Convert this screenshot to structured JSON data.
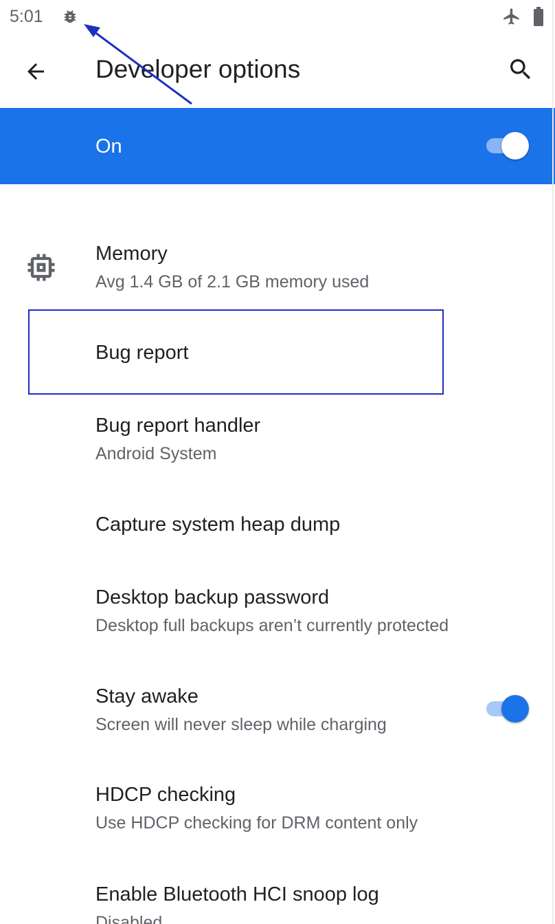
{
  "status_bar": {
    "time": "5:01",
    "icons": [
      "bug-icon",
      "airplane-mode-icon",
      "battery-icon"
    ]
  },
  "app_bar": {
    "title": "Developer options",
    "back_icon": "arrow-back-icon",
    "search_icon": "search-icon"
  },
  "master_switch": {
    "label": "On",
    "checked": true
  },
  "preferences": [
    {
      "title": "Memory",
      "summary": "Avg 1.4 GB of 2.1 GB memory used",
      "icon": "memory-chip-icon"
    },
    {
      "title": "Bug report",
      "summary": ""
    },
    {
      "title": "Bug report handler",
      "summary": "Android System"
    },
    {
      "title": "Capture system heap dump",
      "summary": ""
    },
    {
      "title": "Desktop backup password",
      "summary": "Desktop full backups aren’t currently protected"
    },
    {
      "title": "Stay awake",
      "summary": "Screen will never sleep while charging",
      "switch_checked": true
    },
    {
      "title": "HDCP checking",
      "summary": "Use HDCP checking for DRM content only"
    },
    {
      "title": "Enable Bluetooth HCI snoop log",
      "summary": "Disabled"
    }
  ],
  "colors": {
    "accent": "#1a73e8",
    "annotation": "#1f2fbf"
  }
}
